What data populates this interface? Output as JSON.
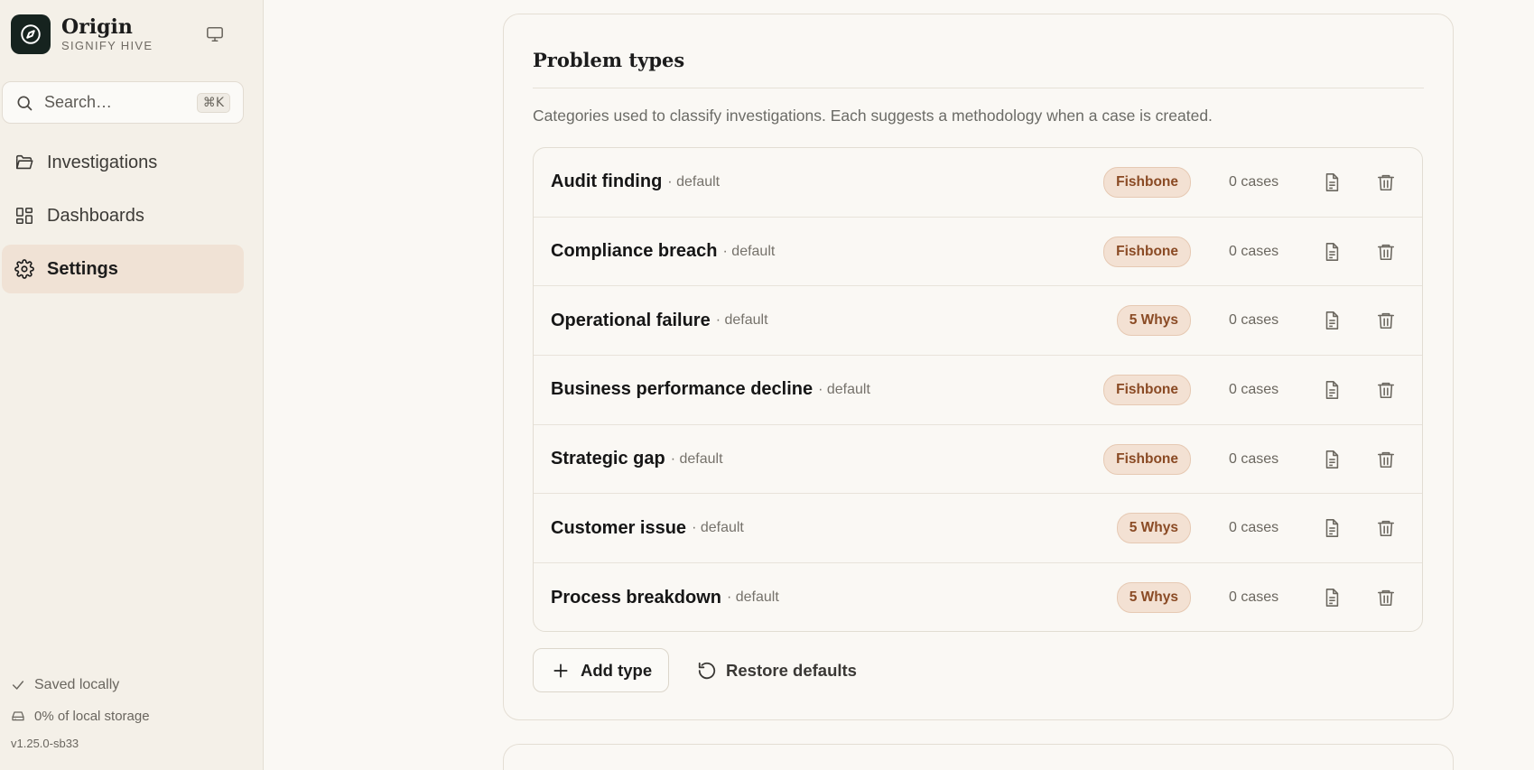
{
  "sidebar": {
    "brand": {
      "title": "Origin",
      "subtitle": "SIGNIFY HIVE"
    },
    "search": {
      "placeholder": "Search…",
      "shortcut": "⌘K"
    },
    "nav": [
      {
        "label": "Investigations",
        "icon": "folder-icon",
        "active": false
      },
      {
        "label": "Dashboards",
        "icon": "dashboard-grid-icon",
        "active": false
      },
      {
        "label": "Settings",
        "icon": "gear-icon",
        "active": true
      }
    ],
    "footer": {
      "saved": "Saved locally",
      "storage": "0% of local storage",
      "version": "v1.25.0-sb33"
    }
  },
  "main": {
    "section": {
      "title": "Problem types",
      "description": "Categories used to classify investigations. Each suggests a methodology when a case is created.",
      "rows": [
        {
          "name": "Audit finding",
          "meta": "· default",
          "method": "Fishbone",
          "cases": "0 cases"
        },
        {
          "name": "Compliance breach",
          "meta": "· default",
          "method": "Fishbone",
          "cases": "0 cases"
        },
        {
          "name": "Operational failure",
          "meta": "· default",
          "method": "5 Whys",
          "cases": "0 cases"
        },
        {
          "name": "Business performance decline",
          "meta": "· default",
          "method": "Fishbone",
          "cases": "0 cases"
        },
        {
          "name": "Strategic gap",
          "meta": "· default",
          "method": "Fishbone",
          "cases": "0 cases"
        },
        {
          "name": "Customer issue",
          "meta": "· default",
          "method": "5 Whys",
          "cases": "0 cases"
        },
        {
          "name": "Process breakdown",
          "meta": "· default",
          "method": "5 Whys",
          "cases": "0 cases"
        }
      ],
      "add_label": "Add type",
      "restore_label": "Restore defaults"
    }
  },
  "colors": {
    "accent_bg": "#f0e2d5",
    "badge_text": "#8a4a24",
    "logo_bg": "#16231f"
  }
}
